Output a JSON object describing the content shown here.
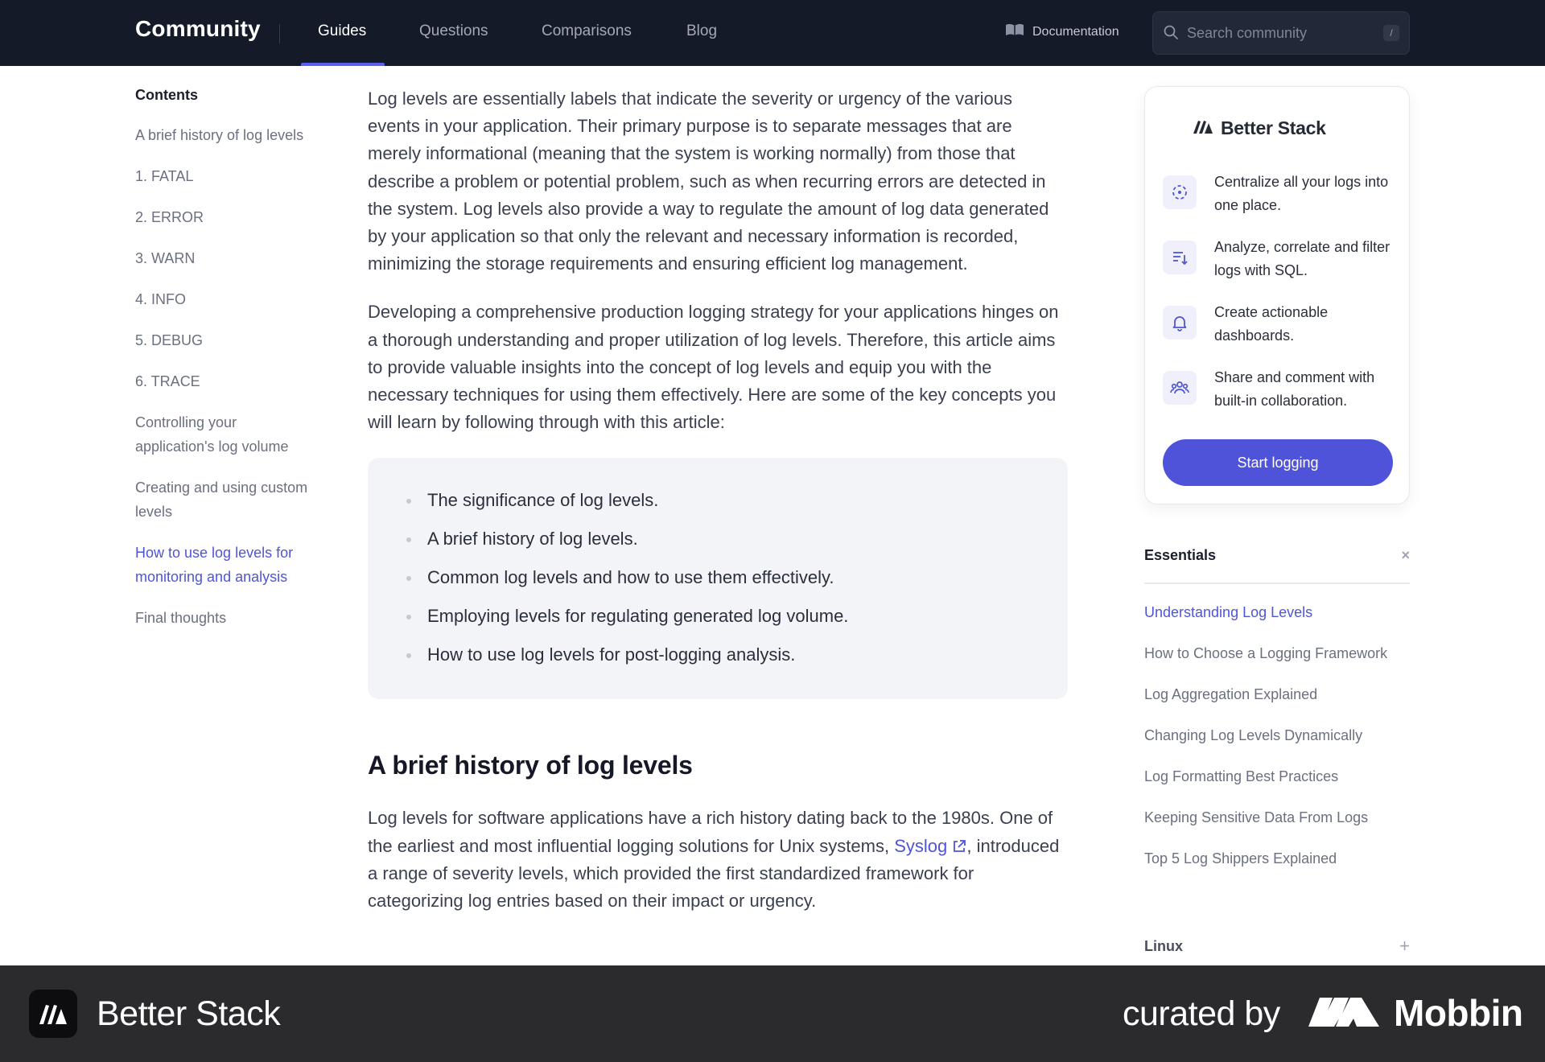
{
  "nav": {
    "brand": "Community",
    "tabs": [
      {
        "label": "Guides"
      },
      {
        "label": "Questions"
      },
      {
        "label": "Comparisons"
      },
      {
        "label": "Blog"
      }
    ],
    "documentation": "Documentation",
    "search_placeholder": "Search community",
    "search_shortcut": "/"
  },
  "toc": {
    "heading": "Contents",
    "items": [
      {
        "label": "A brief history of log levels"
      },
      {
        "label": "1. FATAL"
      },
      {
        "label": "2. ERROR"
      },
      {
        "label": "3. WARN"
      },
      {
        "label": "4. INFO"
      },
      {
        "label": "5. DEBUG"
      },
      {
        "label": "6. TRACE"
      },
      {
        "label": "Controlling your application's log volume"
      },
      {
        "label": "Creating and using custom levels"
      },
      {
        "label": "How to use log levels for monitoring and analysis"
      },
      {
        "label": "Final thoughts"
      }
    ],
    "active_index": 9
  },
  "article": {
    "intro_1": "Log levels are essentially labels that indicate the severity or urgency of the various events in your application. Their primary purpose is to separate messages that are merely informational (meaning that the system is working normally) from those that describe a problem or potential problem, such as when recurring errors are detected in the system. Log levels also provide a way to regulate the amount of log data generated by your application so that only the relevant and necessary information is recorded, minimizing the storage requirements and ensuring efficient log management.",
    "intro_2": "Developing a comprehensive production logging strategy for your applications hinges on a thorough understanding and proper utilization of log levels. Therefore, this article aims to provide valuable insights into the concept of log levels and equip you with the necessary techniques for using them effectively. Here are some of the key concepts you will learn by following through with this article:",
    "key_concepts": [
      "The significance of log levels.",
      "A brief history of log levels.",
      "Common log levels and how to use them effectively.",
      "Employing levels for regulating generated log volume.",
      "How to use log levels for post-logging analysis."
    ],
    "section_heading": "A brief history of log levels",
    "history_before_link": "Log levels for software applications have a rich history dating back to the 1980s. One of the earliest and most influential logging solutions for Unix systems, ",
    "history_link": "Syslog",
    "history_after_link": ", introduced a range of severity levels, which provided the first standardized framework for categorizing log entries based on their impact or urgency."
  },
  "promo": {
    "logo_text": "Better Stack",
    "features": [
      {
        "icon": "centralize-icon",
        "text": "Centralize all your logs into one place."
      },
      {
        "icon": "sql-filter-icon",
        "text": "Analyze, correlate and filter logs with SQL."
      },
      {
        "icon": "bell-icon",
        "text": "Create actionable dashboards."
      },
      {
        "icon": "users-icon",
        "text": "Share and comment with built-in collaboration."
      }
    ],
    "button": "Start logging"
  },
  "essentials": {
    "heading": "Essentials",
    "close_glyph": "×",
    "items": [
      {
        "label": "Understanding Log Levels"
      },
      {
        "label": "How to Choose a Logging Framework"
      },
      {
        "label": "Log Aggregation Explained"
      },
      {
        "label": "Changing Log Levels Dynamically"
      },
      {
        "label": "Log Formatting Best Practices"
      },
      {
        "label": "Keeping Sensitive Data From Logs"
      },
      {
        "label": "Top 5 Log Shippers Explained"
      }
    ],
    "active_index": 0
  },
  "linux": {
    "heading": "Linux",
    "expand_glyph": "+"
  },
  "footer": {
    "brand": "Better Stack",
    "curated_by": "curated by",
    "curator": "Mobbin"
  },
  "colors": {
    "nav_bg": "#151a28",
    "accent": "#5055d3",
    "button": "#4f53d9",
    "footer_bg": "#2b2b2d"
  }
}
